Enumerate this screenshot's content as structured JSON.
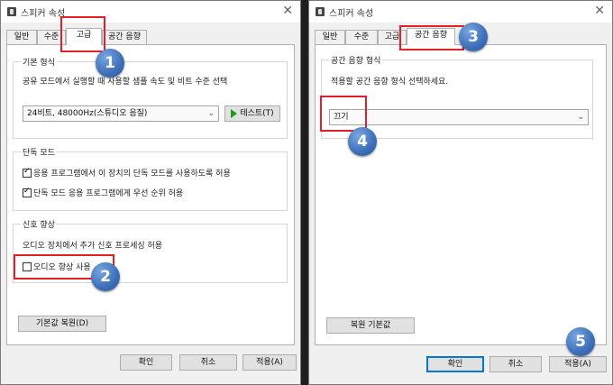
{
  "left_dialog": {
    "title": "스피커 속성",
    "tabs": [
      "일반",
      "수준",
      "고급",
      "공간 음향"
    ],
    "default_format": {
      "group_title": "기본 형식",
      "description": "공유 모드에서 실행할 때 사용할 샘플 속도 및 비트 수준 선택",
      "selected_format": "24비트, 48000Hz(스튜디오 음질)",
      "test_button": "테스트(T)"
    },
    "exclusive_mode": {
      "group_title": "단독 모드",
      "option1": "응용 프로그램에서 이 장치의 단독 모드를 사용하도록 허용",
      "option2": "단독 모드 응용 프로그램에게 우선 순위 허용"
    },
    "signal_enhancement": {
      "group_title": "신호 향상",
      "description": "오디오 장치에서 추가 신호 프로세싱 허용",
      "option": "오디오 향상 사용"
    },
    "restore_button": "기본값 복원(D)",
    "ok_button": "확인",
    "cancel_button": "취소",
    "apply_button": "적용(A)"
  },
  "right_dialog": {
    "title": "스피커 속성",
    "tabs": [
      "일반",
      "수준",
      "고급",
      "공간 음향"
    ],
    "spatial_sound": {
      "group_title": "공간 음향 형식",
      "description": "적용할 공간 음향 형식 선택하세요.",
      "selected": "끄기"
    },
    "restore_button": "복원 기본값",
    "ok_button": "확인",
    "cancel_button": "취소",
    "apply_button": "적용(A)"
  },
  "badges": [
    "1",
    "2",
    "3",
    "4",
    "5"
  ]
}
